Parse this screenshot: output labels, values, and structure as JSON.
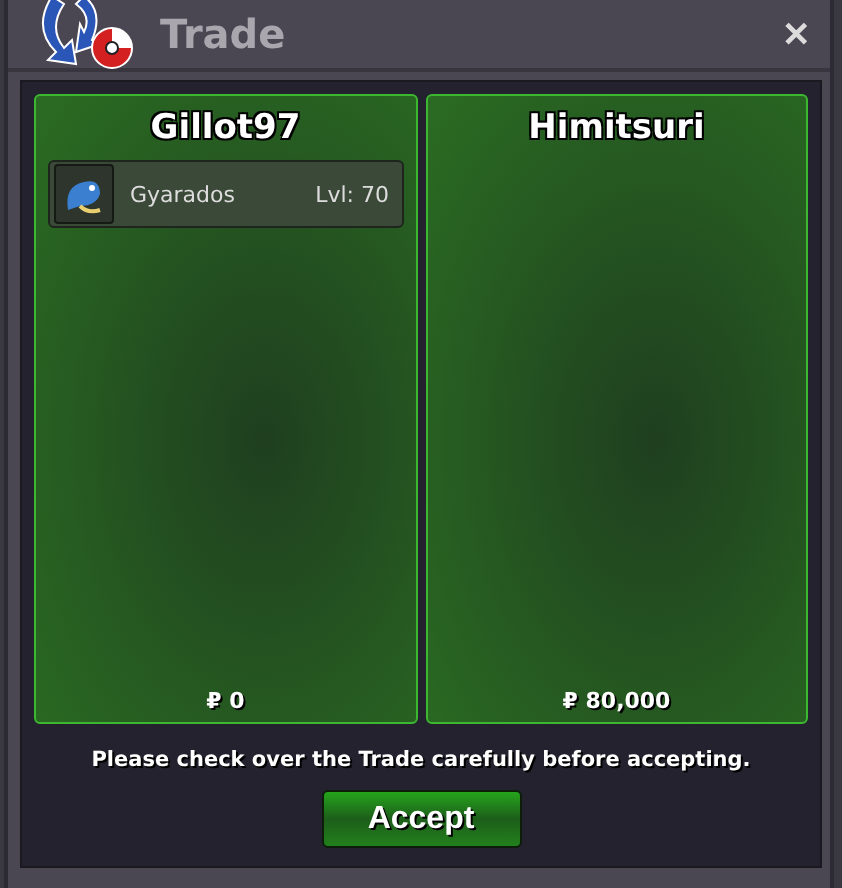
{
  "window": {
    "title": "Trade",
    "close": "✕"
  },
  "panels": [
    {
      "name": "Gillot97",
      "items": [
        {
          "name": "Gyarados",
          "level": "Lvl: 70"
        }
      ],
      "money": "₽ 0"
    },
    {
      "name": "Himitsuri",
      "money": "₽ 80,000"
    }
  ],
  "message": "Please check over the Trade carefully before accepting.",
  "accept_button": "Accept"
}
